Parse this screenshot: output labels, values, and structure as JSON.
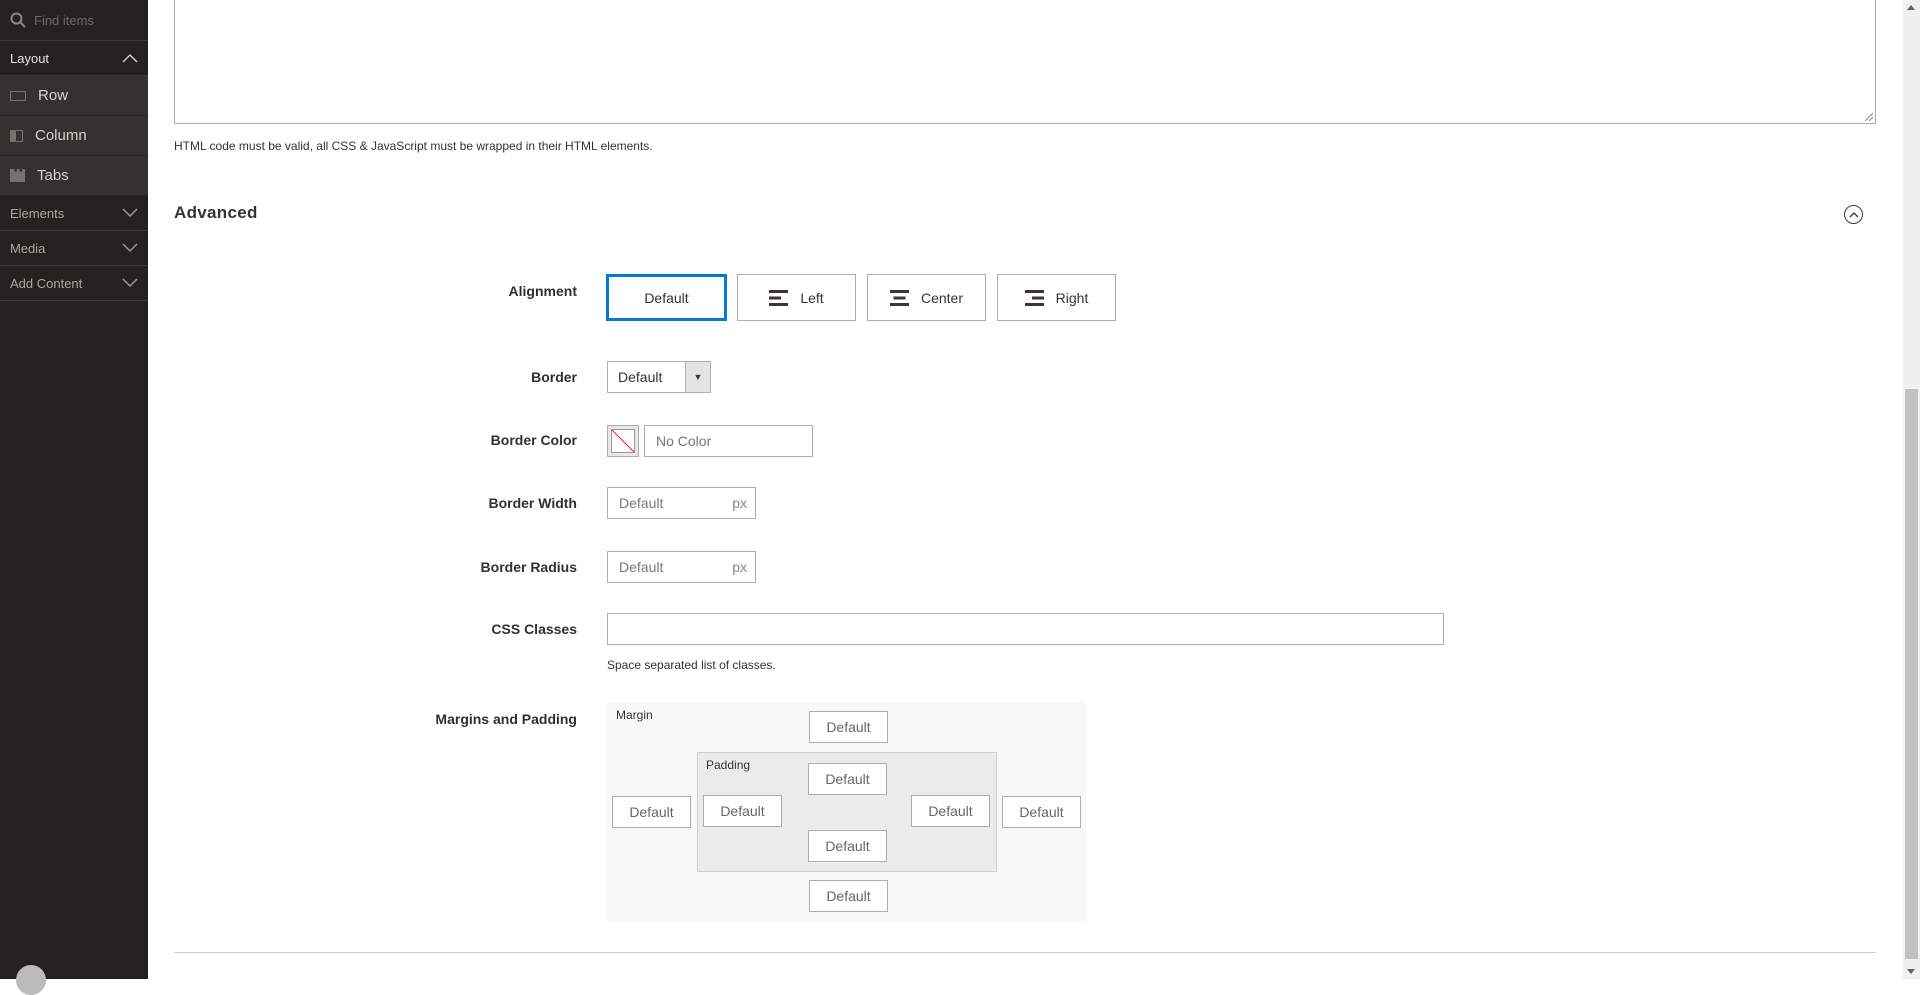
{
  "sidebar": {
    "search_placeholder": "Find items",
    "sections": [
      {
        "label": "Layout",
        "expanded": true,
        "items": [
          {
            "label": "Row",
            "icon": "row-icon"
          },
          {
            "label": "Column",
            "icon": "column-icon"
          },
          {
            "label": "Tabs",
            "icon": "tabs-icon"
          }
        ]
      },
      {
        "label": "Elements",
        "expanded": false
      },
      {
        "label": "Media",
        "expanded": false
      },
      {
        "label": "Add Content",
        "expanded": false
      }
    ]
  },
  "html_note": "HTML code must be valid, all CSS & JavaScript must be wrapped in their HTML elements.",
  "advanced": {
    "title": "Advanced",
    "alignment": {
      "label": "Alignment",
      "options": [
        "Default",
        "Left",
        "Center",
        "Right"
      ],
      "selected": "Default"
    },
    "border": {
      "label": "Border",
      "value": "Default"
    },
    "border_color": {
      "label": "Border Color",
      "placeholder": "No Color"
    },
    "border_width": {
      "label": "Border Width",
      "placeholder": "Default",
      "unit": "px"
    },
    "border_radius": {
      "label": "Border Radius",
      "placeholder": "Default",
      "unit": "px"
    },
    "css_classes": {
      "label": "CSS Classes",
      "value": "",
      "hint": "Space separated list of classes."
    },
    "margins": {
      "label": "Margins and Padding",
      "margin_label": "Margin",
      "padding_label": "Padding",
      "margin_top": "Default",
      "margin_left": "Default",
      "margin_right": "Default",
      "margin_bottom": "Default",
      "padding_top": "Default",
      "padding_left": "Default",
      "padding_right": "Default",
      "padding_bottom": "Default"
    }
  },
  "colors": {
    "sidebar_bg": "#25211e",
    "accent": "#007bdb"
  }
}
